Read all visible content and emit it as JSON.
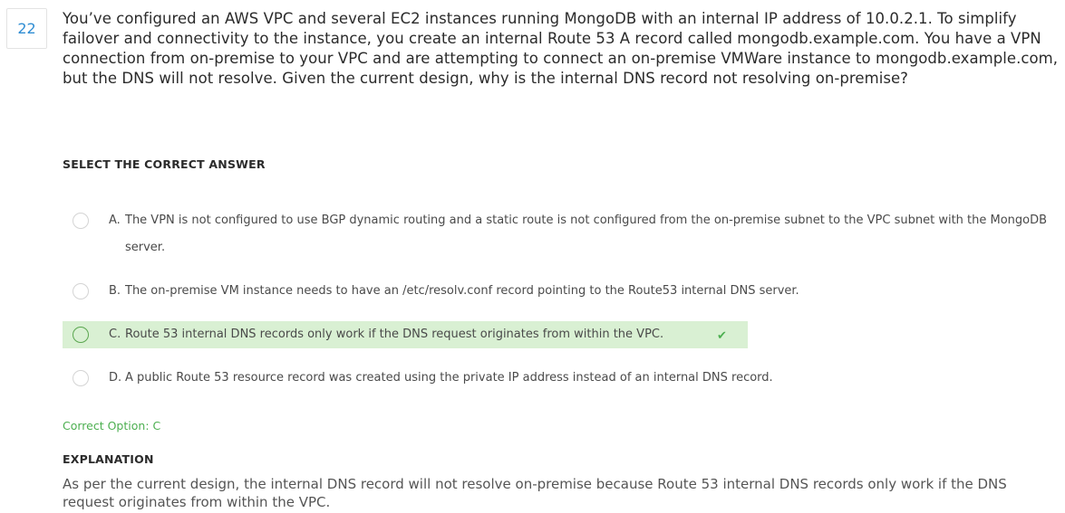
{
  "question": {
    "number": "22",
    "text": "You’ve configured an AWS VPC and several EC2 instances running MongoDB with an internal IP address of 10.0.2.1. To simplify failover and connectivity to the instance, you create an internal Route 53 A record called mongodb.example.com. You have a VPN connection from on-premise to your VPC and are attempting to connect an on-premise VMWare instance to mongodb.example.com, but the DNS will not resolve. Given the current design, why is the internal DNS record not resolving on-premise?"
  },
  "select_heading": "SELECT THE CORRECT ANSWER",
  "options": [
    {
      "letter": "A.",
      "text": "The VPN is not configured to use BGP dynamic routing and a static route is not configured from the on-premise subnet to the VPC subnet with the MongoDB server.",
      "selected": false
    },
    {
      "letter": "B.",
      "text": "The on-premise VM instance needs to have an /etc/resolv.conf record pointing to the Route53 internal DNS server.",
      "selected": false
    },
    {
      "letter": "C.",
      "text": "Route 53 internal DNS records only work if the DNS request originates from within the VPC.",
      "selected": false,
      "correct": true
    },
    {
      "letter": "D.",
      "text": "A public Route 53 resource record was created using the private IP address instead of an internal DNS record.",
      "selected": false
    }
  ],
  "correct_option_label": "Correct Option: C",
  "explanation": {
    "heading": "EXPLANATION",
    "text": "As per the current design, the internal DNS record will not resolve on-premise because Route 53 internal DNS records only work if the DNS request originates from within the VPC."
  },
  "colors": {
    "accent_blue": "#2f8dd3",
    "correct_green": "#4caf50",
    "correct_bg": "#d9f0d3"
  },
  "icons": {
    "check": "check-icon"
  }
}
